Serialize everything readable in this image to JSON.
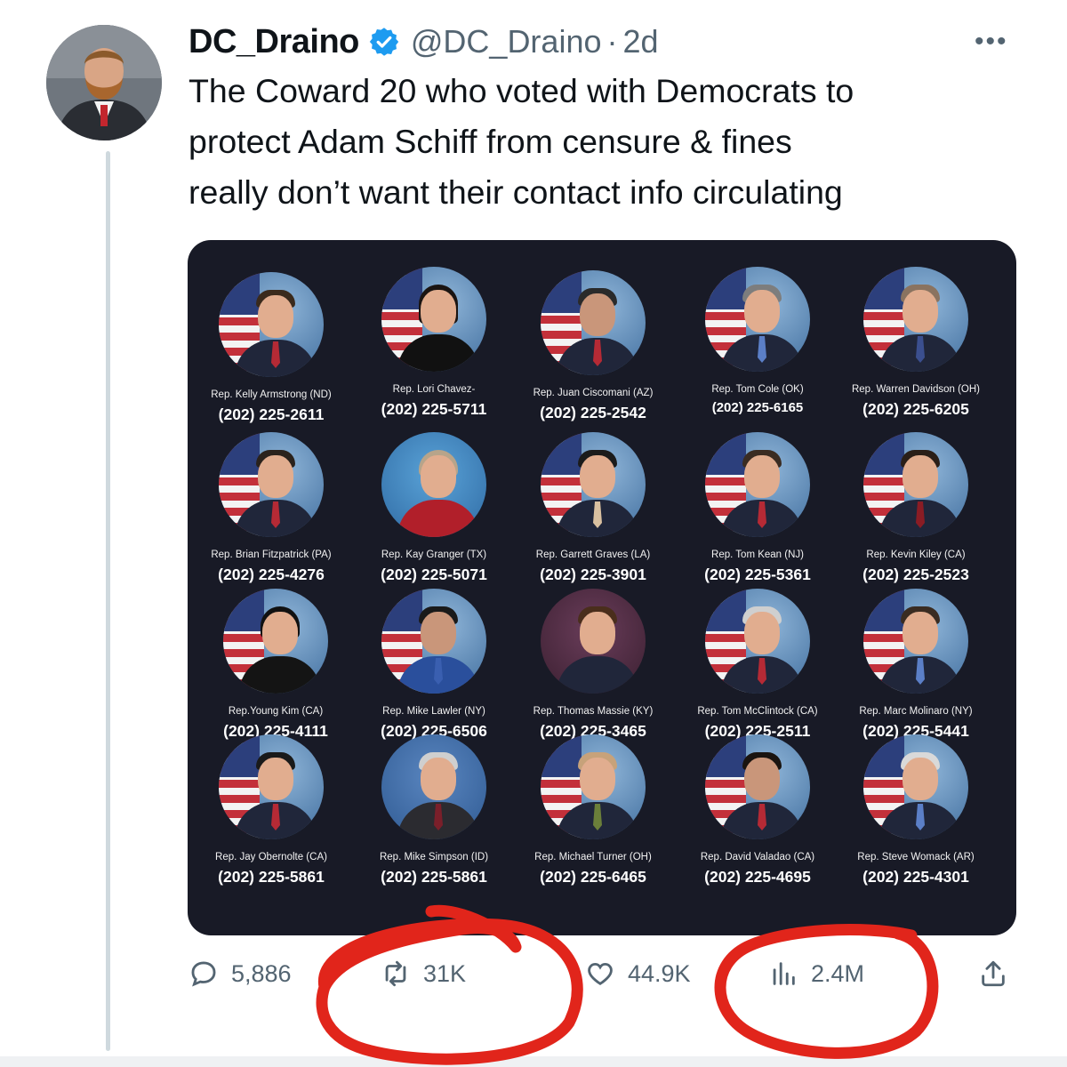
{
  "author": {
    "display_name": "DC_Draino",
    "handle": "@DC_Draino",
    "separator": "·",
    "time": "2d",
    "verified": true
  },
  "tweet": {
    "lines": [
      "The Coward 20 who voted with Democrats to",
      "protect Adam Schiff from censure & fines",
      "really don’t want their contact info circulating"
    ]
  },
  "reps": [
    {
      "name": "Rep. Kelly Armstrong (ND)",
      "phone": "(202) 225-2611"
    },
    {
      "name": "Rep. Lori Chavez-",
      "phone": "(202) 225-5711"
    },
    {
      "name": "Rep. Juan Ciscomani (AZ)",
      "phone": "(202) 225-2542"
    },
    {
      "name": "Rep. Tom Cole (OK)",
      "phone": "(202) 225-6165"
    },
    {
      "name": "Rep. Warren Davidson (OH)",
      "phone": "(202) 225-6205"
    },
    {
      "name": "Rep. Brian Fitzpatrick (PA)",
      "phone": "(202) 225-4276"
    },
    {
      "name": "Rep. Kay Granger (TX)",
      "phone": "(202) 225-5071"
    },
    {
      "name": "Rep. Garrett Graves (LA)",
      "phone": "(202) 225-3901"
    },
    {
      "name": "Rep. Tom Kean (NJ)",
      "phone": "(202) 225-5361"
    },
    {
      "name": "Rep. Kevin Kiley (CA)",
      "phone": "(202) 225-2523"
    },
    {
      "name": "Rep.Young Kim (CA)",
      "phone": "(202) 225-4111"
    },
    {
      "name": "Rep. Mike Lawler (NY)",
      "phone": "(202) 225-6506"
    },
    {
      "name": "Rep. Thomas Massie (KY)",
      "phone": "(202) 225-3465"
    },
    {
      "name": "Rep. Tom McClintock (CA)",
      "phone": "(202) 225-2511"
    },
    {
      "name": "Rep. Marc Molinaro (NY)",
      "phone": "(202) 225-5441"
    },
    {
      "name": "Rep. Jay Obernolte (CA)",
      "phone": "(202) 225-5861"
    },
    {
      "name": "Rep. Mike Simpson (ID)",
      "phone": "(202) 225-5861"
    },
    {
      "name": "Rep. Michael Turner (OH)",
      "phone": "(202) 225-6465"
    },
    {
      "name": "Rep. David Valadao (CA)",
      "phone": "(202) 225-4695"
    },
    {
      "name": "Rep. Steve Womack (AR)",
      "phone": "(202) 225-4301"
    }
  ],
  "actions": {
    "replies": "5,886",
    "reposts": "31K",
    "likes": "44.9K",
    "views": "2.4M"
  },
  "icons": {
    "verified": "verified-badge-icon",
    "more": "more-icon",
    "reply": "reply-icon",
    "repost": "repost-icon",
    "like": "heart-icon",
    "views": "views-icon",
    "share": "share-icon"
  },
  "colors": {
    "text": "#0f1419",
    "secondary": "#536471",
    "verified": "#1d9bf0",
    "media_bg": "#181a26",
    "annotation": "#e1251b"
  }
}
